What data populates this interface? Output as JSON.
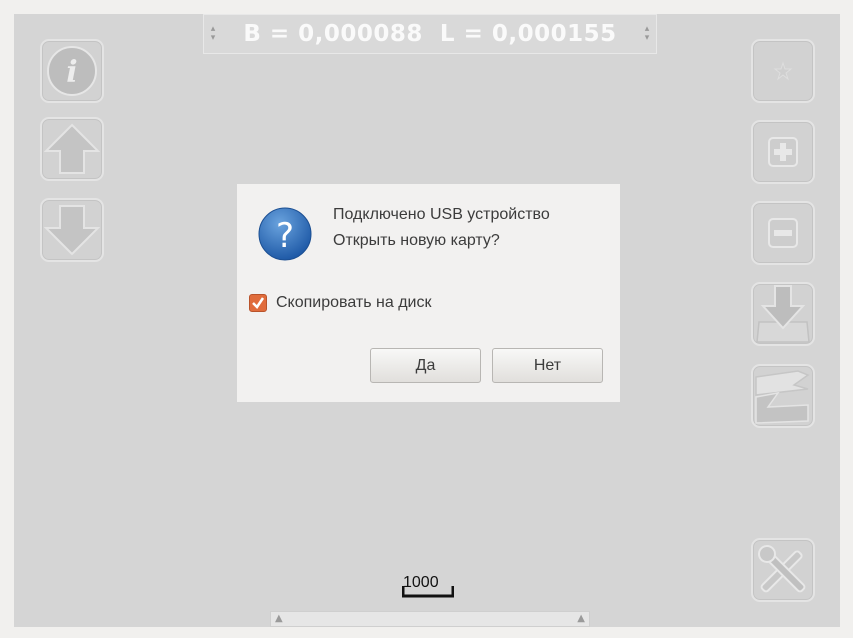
{
  "coordinates": {
    "text": "B = 0,000088  L = 0,000155"
  },
  "left_buttons": [
    {
      "name": "info-button",
      "icon": "info-icon"
    },
    {
      "name": "arrow-up-button",
      "icon": "arrow-up-icon"
    },
    {
      "name": "arrow-down-button",
      "icon": "arrow-down-icon"
    }
  ],
  "right_buttons": [
    {
      "name": "star-button",
      "icon": "star-icon"
    },
    {
      "name": "zoom-in-button",
      "icon": "plus-icon"
    },
    {
      "name": "zoom-out-button",
      "icon": "minus-icon"
    },
    {
      "name": "download-map-button",
      "icon": "download-icon"
    },
    {
      "name": "layers-button",
      "icon": "layers-icon"
    },
    {
      "name": "settings-tools-button",
      "icon": "tools-icon"
    }
  ],
  "dialog": {
    "message_line1": "Подключено USB устройство",
    "message_line2": "Открыть новую карту?",
    "checkbox_label": "Скопировать на диск",
    "checkbox_checked": true,
    "yes_label": "Да",
    "no_label": "Нет",
    "accent_color": "#e06c3c"
  },
  "scale": {
    "label": "1000"
  }
}
